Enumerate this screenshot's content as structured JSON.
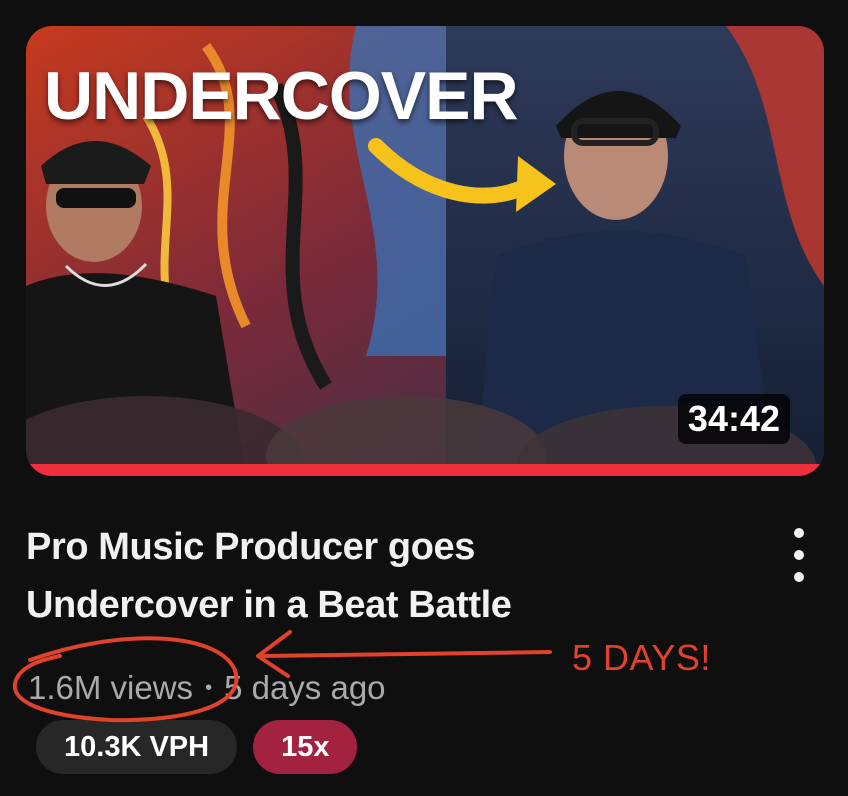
{
  "video": {
    "thumbnail_overlay_text": "UNDERCOVER",
    "duration": "34:42",
    "watch_progress_fraction": 1.0,
    "title_line1": "Pro Music Producer goes",
    "title_line2": "Undercover in a Beat Battle",
    "views": "1.6M views",
    "separator": "•",
    "age": "5 days ago",
    "vph_badge": "10.3K VPH",
    "multiplier_badge": "15x",
    "menu_icon": "more-vert-icon"
  },
  "annotation": {
    "text": "5 DAYS!",
    "color": "#e2412c"
  },
  "colors": {
    "background": "#0f0f0f",
    "progress": "#ef2f3c",
    "multiplier_badge": "#a3223f",
    "vph_badge": "#272727",
    "arrow_in_thumbnail": "#f6c21c"
  }
}
